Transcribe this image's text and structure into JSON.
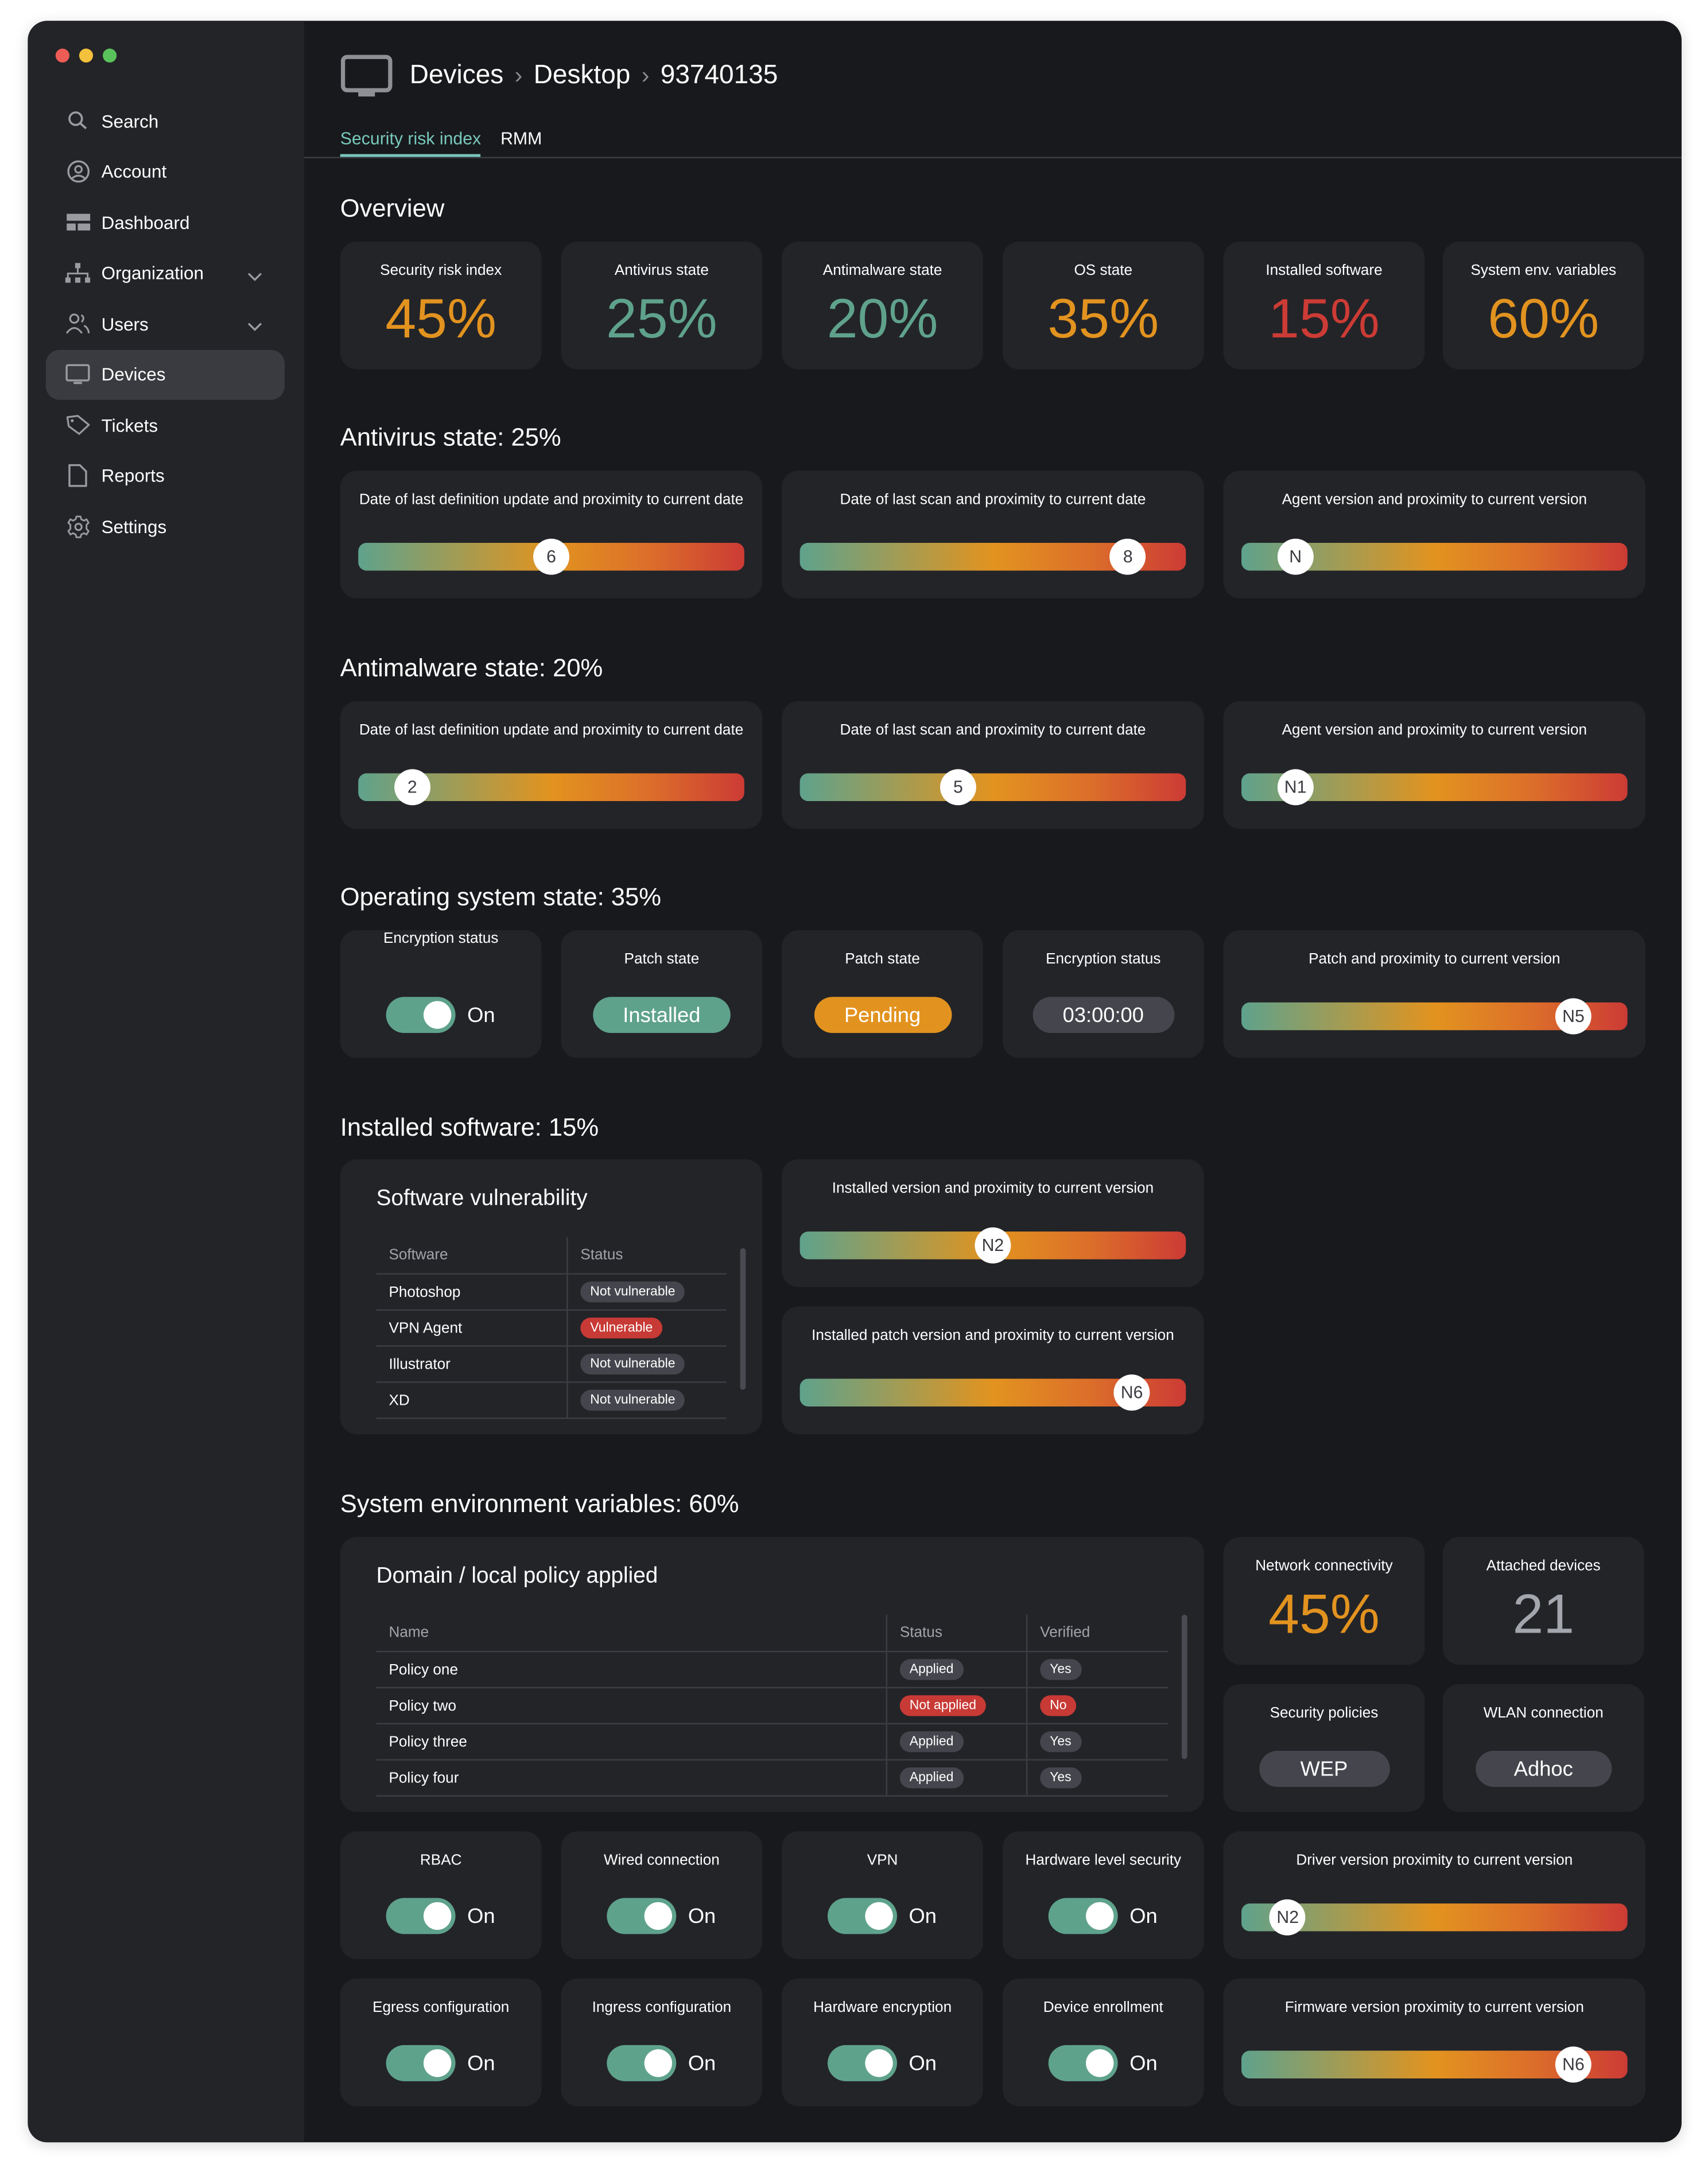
{
  "window": {
    "traffic_lights": [
      "#ee5d55",
      "#f3c13c",
      "#5ac25a"
    ]
  },
  "sidebar": {
    "items": [
      {
        "label": "Search",
        "icon": "search-icon"
      },
      {
        "label": "Account",
        "icon": "account-icon"
      },
      {
        "label": "Dashboard",
        "icon": "dashboard-icon"
      },
      {
        "label": "Organization",
        "icon": "organization-icon",
        "expandable": true
      },
      {
        "label": "Users",
        "icon": "users-icon",
        "expandable": true
      },
      {
        "label": "Devices",
        "icon": "monitor-icon",
        "active": true
      },
      {
        "label": "Tickets",
        "icon": "tag-icon"
      },
      {
        "label": "Reports",
        "icon": "document-icon"
      },
      {
        "label": "Settings",
        "icon": "gear-icon"
      }
    ]
  },
  "header": {
    "breadcrumb": [
      "Devices",
      "Desktop",
      "93740135"
    ],
    "tabs": [
      {
        "label": "Security risk index",
        "active": true
      },
      {
        "label": "RMM",
        "active": false
      }
    ]
  },
  "colors": {
    "teal": "#5fa28c",
    "orange": "#e2931f",
    "red": "#cc3b35",
    "accent_tab": "#78c9bd",
    "neutral_pill": "#45464d"
  },
  "overview": {
    "title": "Overview",
    "stats": [
      {
        "label": "Security risk index",
        "value": "45%",
        "color": "#e2931f"
      },
      {
        "label": "Antivirus state",
        "value": "25%",
        "color": "#5fa28c"
      },
      {
        "label": "Antimalware state",
        "value": "20%",
        "color": "#5fa28c"
      },
      {
        "label": "OS state",
        "value": "35%",
        "color": "#e2931f"
      },
      {
        "label": "Installed software",
        "value": "15%",
        "color": "#cc3b35"
      },
      {
        "label": "System env. variables",
        "value": "60%",
        "color": "#e2931f"
      }
    ]
  },
  "antivirus": {
    "title": "Antivirus state: 25%",
    "sliders": [
      {
        "label": "Date of last definition update and proximity to current date",
        "knob": "6",
        "position_pct": 50
      },
      {
        "label": "Date of last scan and proximity to current date",
        "knob": "8",
        "position_pct": 85
      },
      {
        "label": "Agent version and proximity to current version",
        "knob": "N",
        "position_pct": 14
      }
    ]
  },
  "antimalware": {
    "title": "Antimalware state: 20%",
    "sliders": [
      {
        "label": "Date of last definition update and proximity to current date",
        "knob": "2",
        "position_pct": 14
      },
      {
        "label": "Date of last scan and proximity to current date",
        "knob": "5",
        "position_pct": 41
      },
      {
        "label": "Agent version and proximity to current version",
        "knob": "N1",
        "position_pct": 14
      }
    ]
  },
  "os": {
    "title": "Operating system state: 35%",
    "encryption_status": {
      "label": "Encryption status",
      "state": "On"
    },
    "patch_state_1": {
      "label": "Patch state",
      "value": "Installed",
      "color": "#5fa28c"
    },
    "patch_state_2": {
      "label": "Patch state",
      "value": "Pending",
      "color": "#e2931f"
    },
    "encryption_timer": {
      "label": "Encryption status",
      "value": "03:00:00",
      "color": "#45464d"
    },
    "slider": {
      "label": "Patch and proximity to current version",
      "knob": "N5",
      "position_pct": 86
    }
  },
  "software": {
    "title": "Installed software: 15%",
    "vuln_table": {
      "title": "Software vulnerability",
      "columns": [
        "Software",
        "Status"
      ],
      "rows": [
        {
          "software": "Photoshop",
          "status": "Not vulnerable",
          "bad": false
        },
        {
          "software": "VPN Agent",
          "status": "Vulnerable",
          "bad": true
        },
        {
          "software": "Illustrator",
          "status": "Not vulnerable",
          "bad": false
        },
        {
          "software": "XD",
          "status": "Not vulnerable",
          "bad": false
        }
      ]
    },
    "sliders": [
      {
        "label": "Installed version and proximity to current version",
        "knob": "N2",
        "position_pct": 50
      },
      {
        "label": "Installed patch version and proximity to current version",
        "knob": "N6",
        "position_pct": 86
      }
    ]
  },
  "sysenv": {
    "title": "System environment variables: 60%",
    "policy_table": {
      "title": "Domain / local policy applied",
      "columns": [
        "Name",
        "Status",
        "Verified"
      ],
      "rows": [
        {
          "name": "Policy one",
          "status": "Applied",
          "verified": "Yes",
          "bad": false
        },
        {
          "name": "Policy two",
          "status": "Not applied",
          "verified": "No",
          "bad": true
        },
        {
          "name": "Policy three",
          "status": "Applied",
          "verified": "Yes",
          "bad": false
        },
        {
          "name": "Policy four",
          "status": "Applied",
          "verified": "Yes",
          "bad": false
        }
      ]
    },
    "network_connectivity": {
      "label": "Network connectivity",
      "value": "45%",
      "color": "#e2931f"
    },
    "attached_devices": {
      "label": "Attached devices",
      "value": "21",
      "color": "#a4a6ae"
    },
    "security_policies": {
      "label": "Security policies",
      "value": "WEP"
    },
    "wlan_connection": {
      "label": "WLAN connection",
      "value": "Adhoc"
    },
    "toggles": [
      {
        "label": "RBAC",
        "state": "On"
      },
      {
        "label": "Wired connection",
        "state": "On"
      },
      {
        "label": "VPN",
        "state": "On"
      },
      {
        "label": "Hardware level security",
        "state": "On"
      },
      {
        "label": "Egress configuration",
        "state": "On"
      },
      {
        "label": "Ingress configuration",
        "state": "On"
      },
      {
        "label": "Hardware encryption",
        "state": "On"
      },
      {
        "label": "Device enrollment",
        "state": "On"
      }
    ],
    "sliders": [
      {
        "label": "Driver version proximity to current version",
        "knob": "N2",
        "position_pct": 12
      },
      {
        "label": "Firmware version proximity to current version",
        "knob": "N6",
        "position_pct": 86
      }
    ]
  }
}
